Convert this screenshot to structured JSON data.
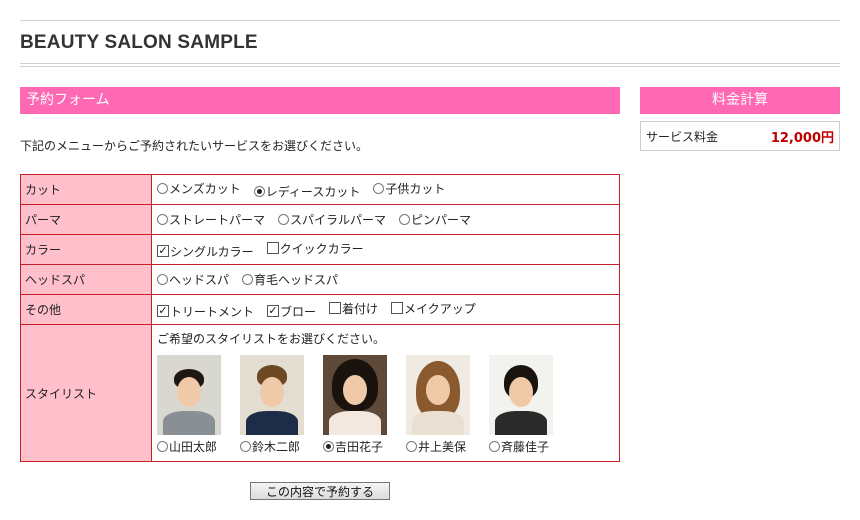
{
  "site": {
    "title": "BEAUTY SALON SAMPLE"
  },
  "form": {
    "heading": "予約フォーム",
    "intro": "下記のメニューからご予約されたいサービスをお選びください。",
    "rows": [
      {
        "label": "カット",
        "type": "radio",
        "options": [
          {
            "label": "メンズカット",
            "selected": false
          },
          {
            "label": "レディースカット",
            "selected": true
          },
          {
            "label": "子供カット",
            "selected": false
          }
        ]
      },
      {
        "label": "パーマ",
        "type": "radio",
        "options": [
          {
            "label": "ストレートパーマ",
            "selected": false
          },
          {
            "label": "スパイラルパーマ",
            "selected": false
          },
          {
            "label": "ピンパーマ",
            "selected": false
          }
        ]
      },
      {
        "label": "カラー",
        "type": "checkbox",
        "options": [
          {
            "label": "シングルカラー",
            "selected": true
          },
          {
            "label": "クイックカラー",
            "selected": false
          }
        ]
      },
      {
        "label": "ヘッドスパ",
        "type": "radio",
        "options": [
          {
            "label": "ヘッドスパ",
            "selected": false
          },
          {
            "label": "育毛ヘッドスパ",
            "selected": false
          }
        ]
      },
      {
        "label": "その他",
        "type": "checkbox",
        "options": [
          {
            "label": "トリートメント",
            "selected": true
          },
          {
            "label": "ブロー",
            "selected": true
          },
          {
            "label": "着付け",
            "selected": false
          },
          {
            "label": "メイクアップ",
            "selected": false
          }
        ]
      }
    ],
    "stylist": {
      "label": "スタイリスト",
      "prompt": "ご希望のスタイリストをお選びください。",
      "options": [
        {
          "name": "山田太郎",
          "selected": false
        },
        {
          "name": "鈴木二郎",
          "selected": false
        },
        {
          "name": "吉田花子",
          "selected": true
        },
        {
          "name": "井上美保",
          "selected": false
        },
        {
          "name": "斉藤佳子",
          "selected": false
        }
      ]
    },
    "submit_label": "この内容で予約する"
  },
  "calc": {
    "heading": "料金計算",
    "price_label": "サービス料金",
    "price_value": "12,000円"
  },
  "colors": {
    "accent": "#ff69b4",
    "label_bg": "#ffc0cb",
    "border": "#c8202a",
    "price": "#c00000"
  }
}
